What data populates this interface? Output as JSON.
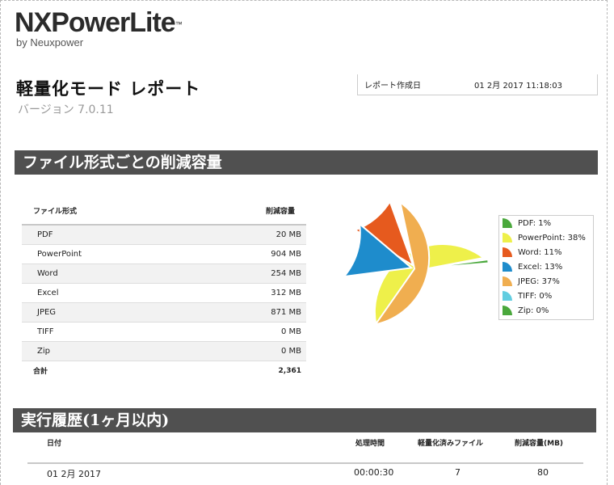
{
  "logo": {
    "name": "NXPowerLite",
    "tm": "™",
    "by": "by Neuxpower"
  },
  "report": {
    "title": "軽量化モード レポート",
    "version": "バージョン  7.0.11"
  },
  "meta": {
    "label": "レポート作成日",
    "value": "01 2月 2017 11:18:03"
  },
  "section1": {
    "title": "ファイル形式ごとの削減容量"
  },
  "table": {
    "headers": [
      "ファイル形式",
      "削減容量"
    ],
    "rows": [
      {
        "type": "PDF",
        "size": "20 MB"
      },
      {
        "type": "PowerPoint",
        "size": "904 MB"
      },
      {
        "type": "Word",
        "size": "254 MB"
      },
      {
        "type": "Excel",
        "size": "312 MB"
      },
      {
        "type": "JPEG",
        "size": "871 MB"
      },
      {
        "type": "TIFF",
        "size": "0 MB"
      },
      {
        "type": "Zip",
        "size": "0 MB"
      }
    ],
    "total_label": "合計",
    "total_value": "2,361"
  },
  "chart_data": {
    "type": "pie",
    "categories": [
      "PDF",
      "PowerPoint",
      "Word",
      "Excel",
      "JPEG",
      "TIFF",
      "Zip"
    ],
    "values": [
      20,
      904,
      254,
      312,
      871,
      0,
      0
    ],
    "percent_labels": [
      "PDF: 1%",
      "PowerPoint: 38%",
      "Word: 11%",
      "Excel: 13%",
      "JPEG: 37%",
      "TIFF: 0%",
      "Zip: 0%"
    ],
    "colors": [
      "#4aa83c",
      "#eef04a",
      "#e65a1e",
      "#1e8ccc",
      "#f0ae50",
      "#62cde0",
      "#4aa83c"
    ],
    "legend_position": "right"
  },
  "section2": {
    "title": "実行履歴(1ヶ月以内)"
  },
  "history": {
    "headers": [
      "日付",
      "処理時間",
      "軽量化済みファイル",
      "削減容量(MB)"
    ],
    "rows": [
      {
        "date": "01 2月 2017",
        "time": "00:00:30",
        "files": "7",
        "saved": "80"
      }
    ]
  }
}
